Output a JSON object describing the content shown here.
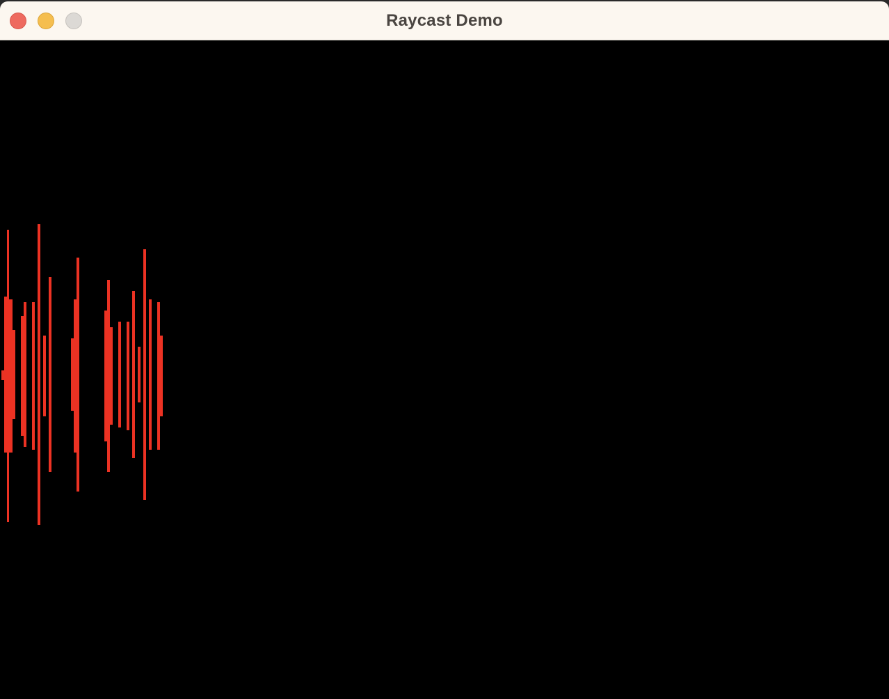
{
  "window": {
    "title": "Raycast Demo"
  },
  "colors": {
    "wall": "#ec3223",
    "background": "#000000"
  },
  "icons": {
    "close": "close-icon",
    "minimize": "minimize-icon",
    "zoom": "zoom-icon"
  }
}
